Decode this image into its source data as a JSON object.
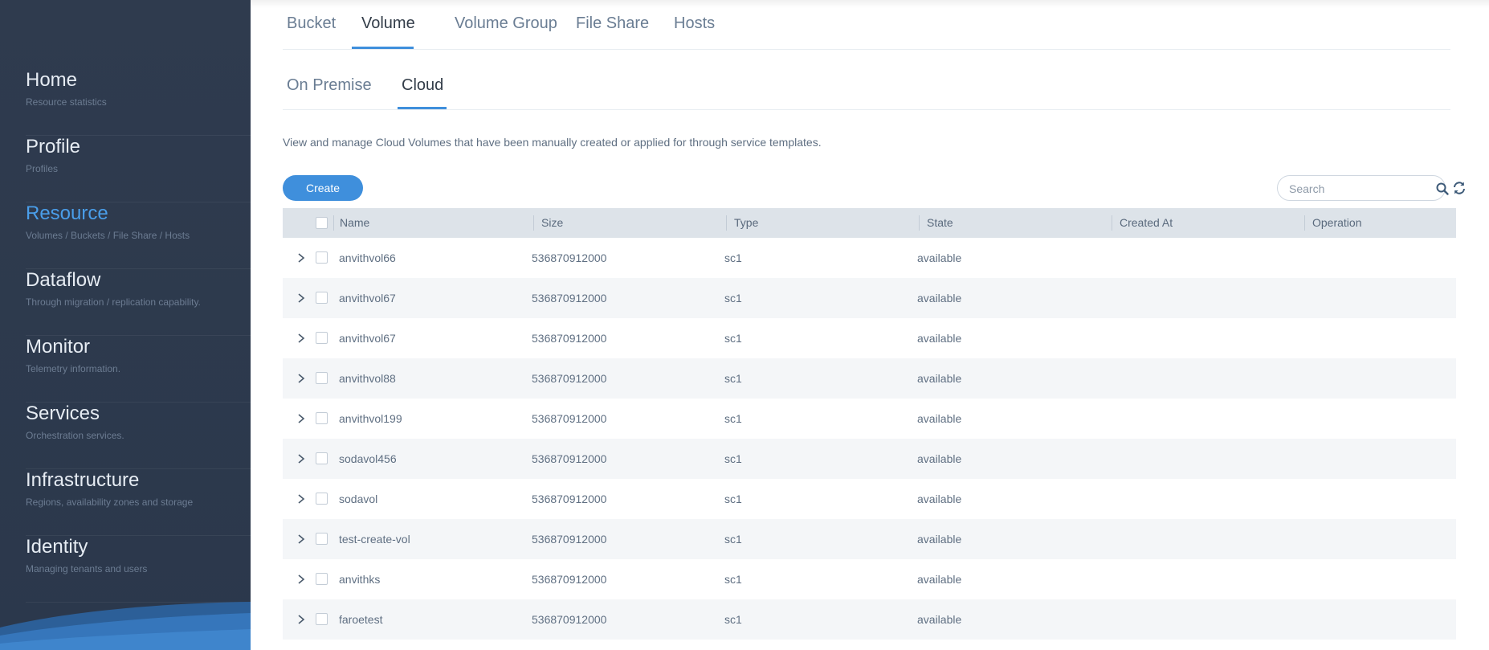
{
  "sidebar": {
    "items": [
      {
        "title": "Home",
        "subtitle": "Resource statistics",
        "active": false
      },
      {
        "title": "Profile",
        "subtitle": "Profiles",
        "active": false
      },
      {
        "title": "Resource",
        "subtitle": "Volumes / Buckets / File Share / Hosts",
        "active": true
      },
      {
        "title": "Dataflow",
        "subtitle": "Through migration / replication capability.",
        "active": false
      },
      {
        "title": "Monitor",
        "subtitle": "Telemetry information.",
        "active": false
      },
      {
        "title": "Services",
        "subtitle": "Orchestration services.",
        "active": false
      },
      {
        "title": "Infrastructure",
        "subtitle": "Regions, availability zones and storage",
        "active": false
      },
      {
        "title": "Identity",
        "subtitle": "Managing tenants and users",
        "active": false
      }
    ]
  },
  "tabs": {
    "primary": [
      {
        "label": "Bucket"
      },
      {
        "label": "Volume",
        "active": true
      },
      {
        "label": "Volume Group"
      },
      {
        "label": "File Share"
      },
      {
        "label": "Hosts"
      }
    ],
    "secondary": [
      {
        "label": "On Premise"
      },
      {
        "label": "Cloud",
        "active": true
      }
    ]
  },
  "description": "View and manage Cloud Volumes that have been manually created or applied for through service templates.",
  "toolbar": {
    "create_label": "Create",
    "search_placeholder": "Search"
  },
  "table": {
    "columns": [
      "Name",
      "Size",
      "Type",
      "State",
      "Created At",
      "Operation"
    ],
    "rows": [
      {
        "name": "anvithvol66",
        "size": "536870912000",
        "type": "sc1",
        "state": "available",
        "created_at": "",
        "operation": ""
      },
      {
        "name": "anvithvol67",
        "size": "536870912000",
        "type": "sc1",
        "state": "available",
        "created_at": "",
        "operation": ""
      },
      {
        "name": "anvithvol67",
        "size": "536870912000",
        "type": "sc1",
        "state": "available",
        "created_at": "",
        "operation": ""
      },
      {
        "name": "anvithvol88",
        "size": "536870912000",
        "type": "sc1",
        "state": "available",
        "created_at": "",
        "operation": ""
      },
      {
        "name": "anvithvol199",
        "size": "536870912000",
        "type": "sc1",
        "state": "available",
        "created_at": "",
        "operation": ""
      },
      {
        "name": "sodavol456",
        "size": "536870912000",
        "type": "sc1",
        "state": "available",
        "created_at": "",
        "operation": ""
      },
      {
        "name": "sodavol",
        "size": "536870912000",
        "type": "sc1",
        "state": "available",
        "created_at": "",
        "operation": ""
      },
      {
        "name": "test-create-vol",
        "size": "536870912000",
        "type": "sc1",
        "state": "available",
        "created_at": "",
        "operation": ""
      },
      {
        "name": "anvithks",
        "size": "536870912000",
        "type": "sc1",
        "state": "available",
        "created_at": "",
        "operation": ""
      },
      {
        "name": "faroetest",
        "size": "536870912000",
        "type": "sc1",
        "state": "available",
        "created_at": "",
        "operation": ""
      }
    ]
  },
  "colors": {
    "accent": "#3f8fdc",
    "sidebar_bg": "#2f3b4e",
    "active_nav": "#4a9eea"
  },
  "icons": {
    "search": "search-icon",
    "refresh": "refresh-icon",
    "expand": "chevron-right-icon"
  }
}
